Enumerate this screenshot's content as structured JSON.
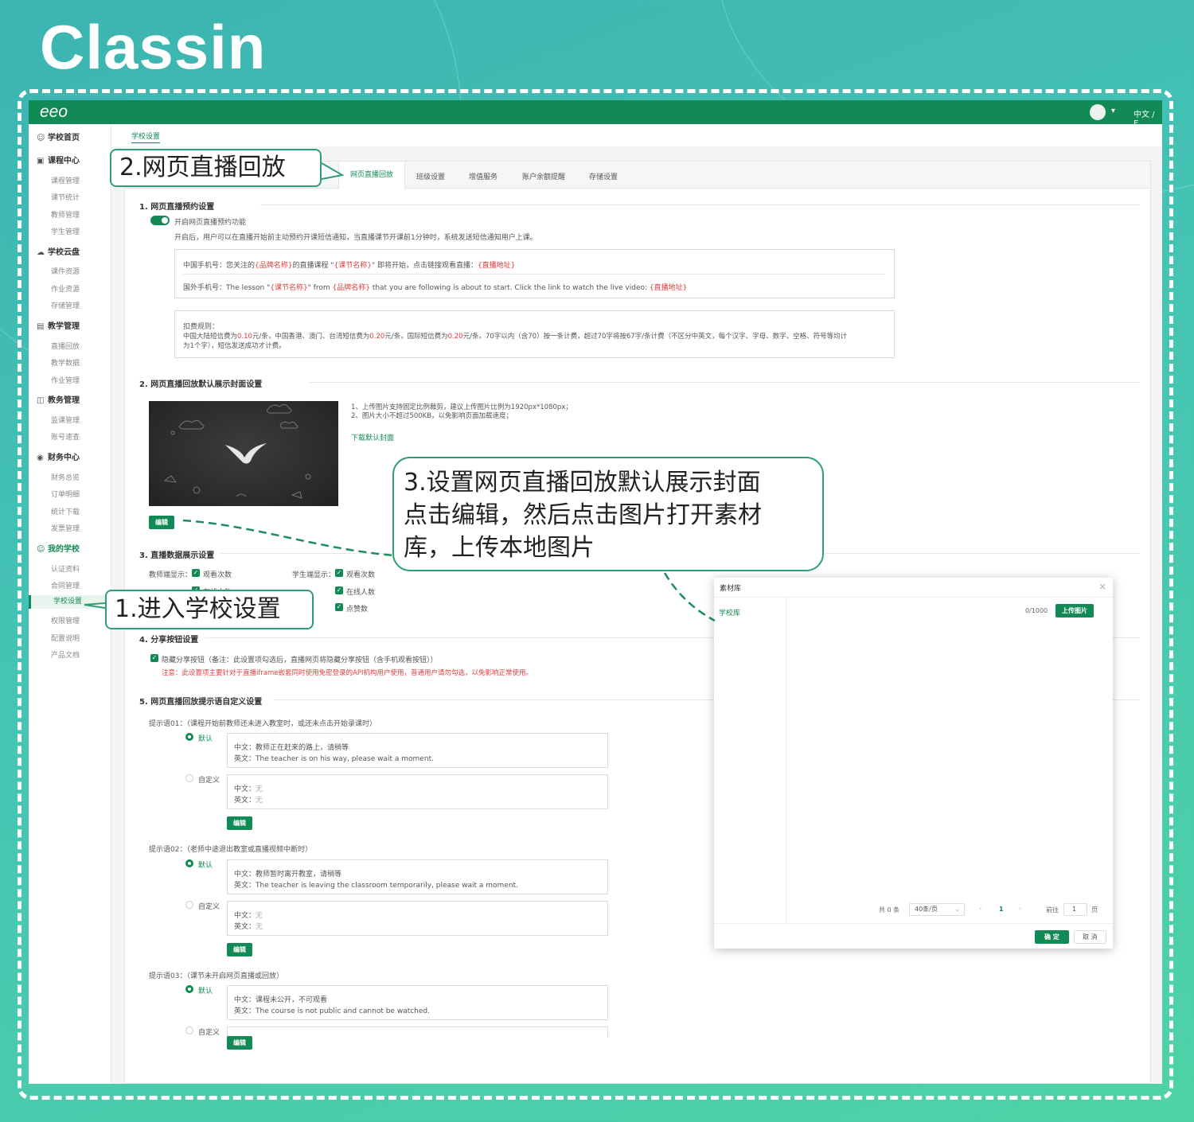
{
  "brand": "Classin",
  "topbar": {
    "logo": "eeo",
    "lang": "中文 / E"
  },
  "sidebar": {
    "groups": [
      {
        "label": "学校首页",
        "icon": "☺"
      },
      {
        "label": "课程中心",
        "icon": "▣"
      },
      {
        "label": "学校云盘",
        "icon": "☁"
      },
      {
        "label": "教学管理",
        "icon": "▤"
      },
      {
        "label": "教务管理",
        "icon": "◫"
      },
      {
        "label": "财务中心",
        "icon": "◉"
      },
      {
        "label": "我的学校",
        "icon": "☺"
      }
    ],
    "items": [
      "课程管理",
      "课节统计",
      "教师管理",
      "学生管理",
      "课件资源",
      "作业资源",
      "存储管理",
      "直播回放",
      "教学数据",
      "作业管理",
      "监课管理",
      "账号速查",
      "财务总览",
      "订单明细",
      "统计下载",
      "发票管理",
      "认证资料",
      "合同管理",
      "学校设置",
      "权限管理",
      "配置说明",
      "产品文档"
    ]
  },
  "breadcrumb": "学校设置",
  "tabs": [
    "网页直播回放",
    "班级设置",
    "增值服务",
    "账户余额提醒",
    "存储设置"
  ],
  "s1": {
    "title": "1. 网页直播预约设置",
    "toggle_label": "开启网页直播预约功能",
    "desc": "开启后，用户可以在直播开始前主动预约开课短信通知，当直播课节开课前1分钟时，系统发送短信通知用户上课。",
    "cn_a": "中国手机号：您关注的",
    "cn_b": "{品牌名称}",
    "cn_c": "的直播课程 \"",
    "cn_d": "{课节名称}",
    "cn_e": "\" 即将开始，点击链接观看直播：",
    "cn_f": "{直播地址}",
    "en_a": "国外手机号：The lesson \"",
    "en_b": "{课节名称}",
    "en_c": "\" from ",
    "en_d": "{品牌名称}",
    "en_e": " that you are following is about to start. Click the link to watch the live video: ",
    "en_f": "{直播地址}",
    "rule_title": "扣费规则：",
    "rule1_a": "中国大陆短信费为",
    "rule1_b": "0.10",
    "rule1_c": "元/条，中国香港、澳门、台湾短信费为",
    "rule1_d": "0.20",
    "rule1_e": "元/条，国际短信费为",
    "rule1_f": "0.20",
    "rule1_g": "元/条。70字以内（含70）按一条计费，超过70字将按67字/条计费（不区分中英文，每个汉字、字母、数字、空格、符号等均计",
    "rule2": "为1个字），短信发送成功才计费。"
  },
  "s2": {
    "title": "2. 网页直播回放默认展示封面设置",
    "note1": "1、上传图片支持固定比例裁剪，建议上传图片比例为1920px*1080px；",
    "note2": "2、图片大小不超过500KB，以免影响页面加载速度；",
    "download": "下载默认封面",
    "edit": "编辑"
  },
  "s3": {
    "title": "3. 直播数据展示设置",
    "teacher_label": "教师端显示：",
    "student_label": "学生端显示：",
    "t_opts": [
      "观看次数",
      "在线人数"
    ],
    "s_opts": [
      "观看次数",
      "在线人数",
      "点赞数"
    ]
  },
  "s4": {
    "title": "4. 分享按钮设置",
    "cb_label": "隐藏分享按钮（备注：此设置项勾选后，直播网页将隐藏分享按钮（含手机观看按钮））",
    "warn": "注意：此设置项主要针对于直播iframe嵌套同时使用免密登录的API机构用户使用，普通用户请勿勾选，以免影响正常使用。"
  },
  "s5": {
    "title": "5. 网页直播回放提示语自定义设置",
    "default": "默认",
    "custom": "自定义",
    "cn_prefix": "中文：",
    "en_prefix": "英文：",
    "none": "无",
    "edit": "编辑",
    "tips": [
      {
        "label": "提示语01：（课程开始前教师还未进入教室时，或还未点击开始录课时）",
        "cn": "教师正在赶来的路上，请稍等",
        "en": "The teacher is on his way, please wait a moment."
      },
      {
        "label": "提示语02：（老师中途退出教室或直播视频中断时）",
        "cn": "教师暂时离开教室，请稍等",
        "en": "The teacher is leaving the classroom temporarily, please wait a moment."
      },
      {
        "label": "提示语03：（课节未开启网页直播或回放）",
        "cn": "课程未公开，不可观看",
        "en": "The course is not public and cannot be watched."
      }
    ]
  },
  "modal": {
    "title": "素材库",
    "left_item": "学校库",
    "count": "0/1000",
    "upload": "上传图片",
    "total": "共 0 条",
    "page_size": "40条/页",
    "page": "1",
    "goto": "前往",
    "goto_val": "1",
    "page_unit": "页",
    "ok": "确 定",
    "cancel": "取 消"
  },
  "callouts": {
    "c1": "1.进入学校设置",
    "c2": "2.网页直播回放",
    "c3": [
      "3.设置网页直播回放默认展示封面",
      "点击编辑，然后点击图片打开素材",
      "库，上传本地图片"
    ]
  }
}
